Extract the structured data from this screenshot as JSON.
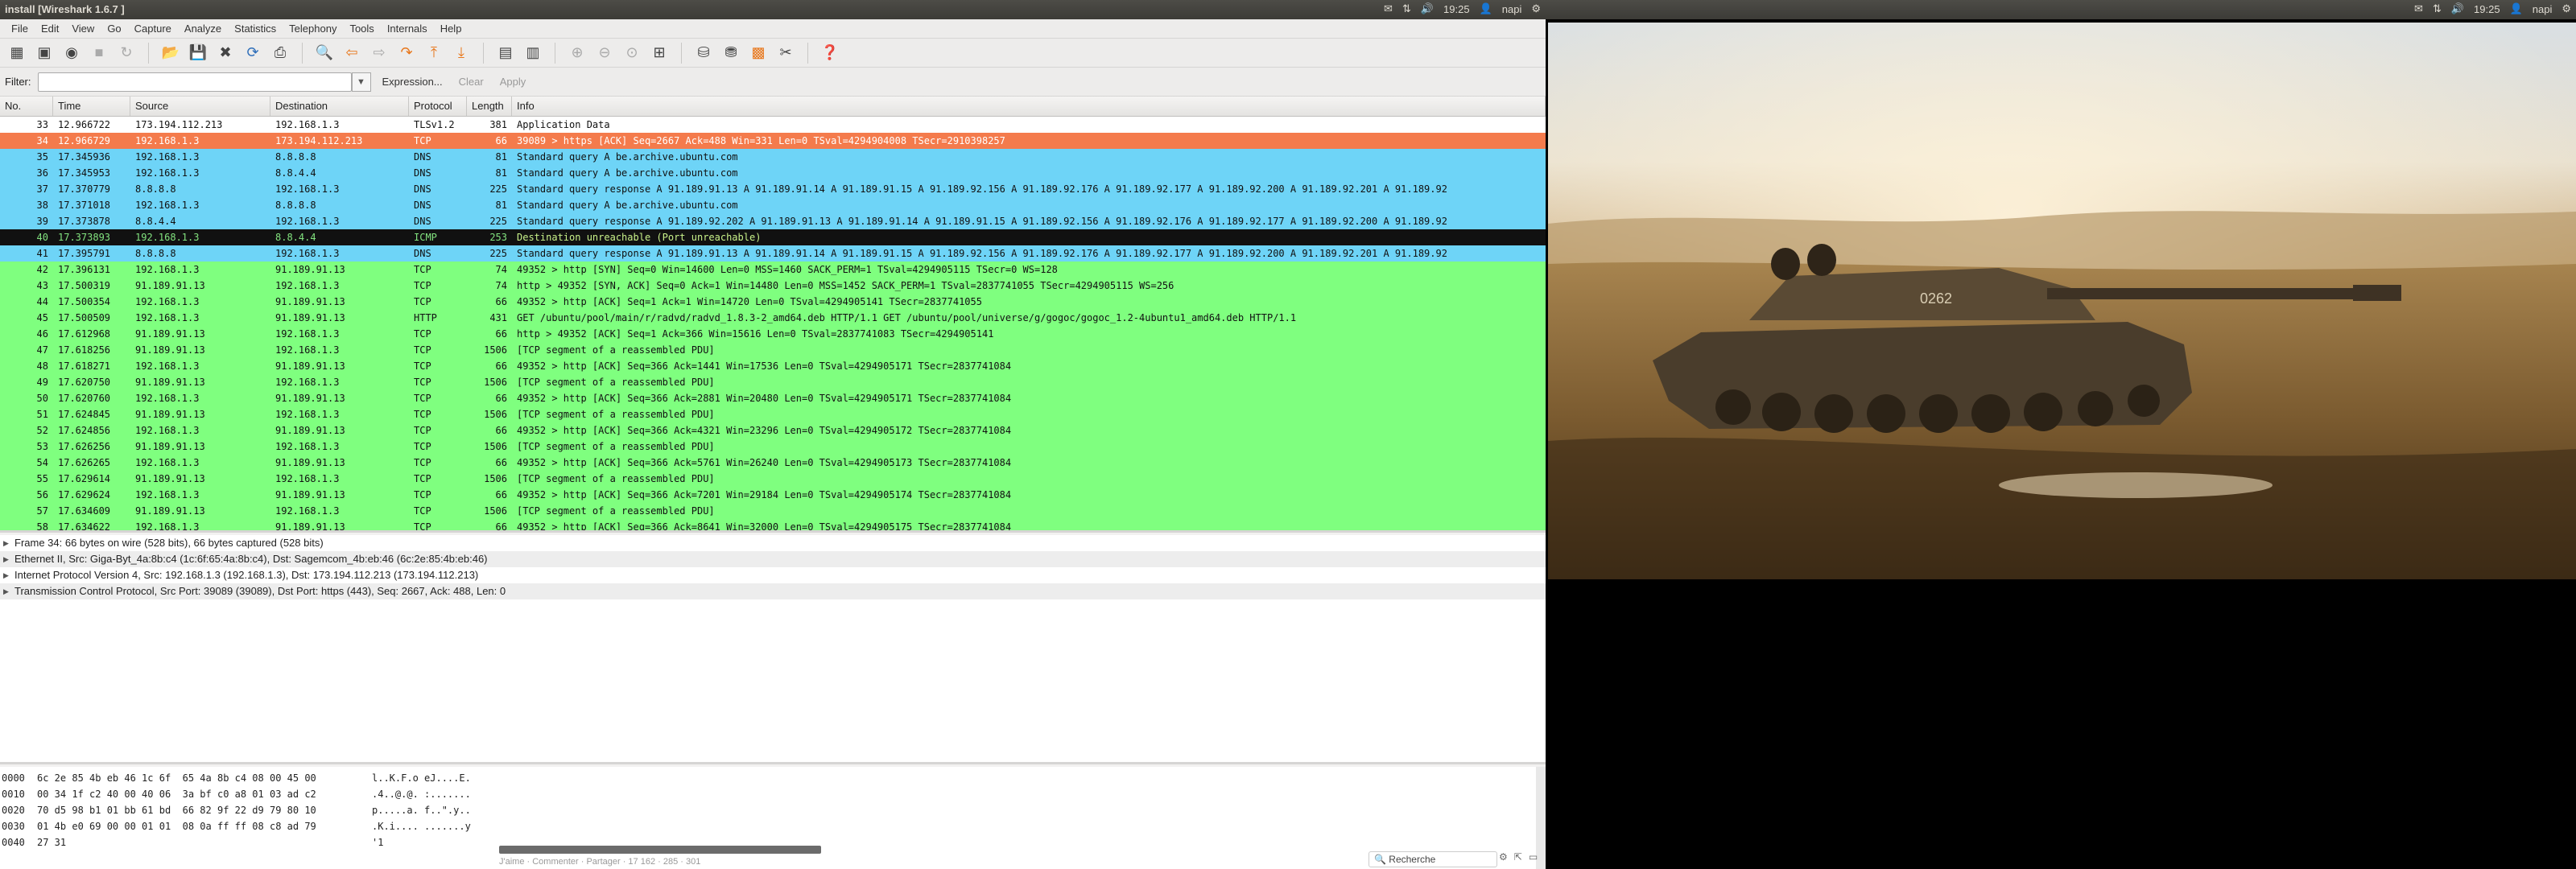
{
  "left_topbar": {
    "title": "install  [Wireshark 1.6.7 ]",
    "time": "19:25",
    "user": "napi"
  },
  "right_topbar": {
    "time": "19:25",
    "user": "napi"
  },
  "menu": [
    "File",
    "Edit",
    "View",
    "Go",
    "Capture",
    "Analyze",
    "Statistics",
    "Telephony",
    "Tools",
    "Internals",
    "Help"
  ],
  "filter": {
    "label": "Filter:",
    "value": "",
    "expression": "Expression...",
    "clear": "Clear",
    "apply": "Apply"
  },
  "columns": {
    "no": "No.",
    "time": "Time",
    "source": "Source",
    "destination": "Destination",
    "protocol": "Protocol",
    "length": "Length",
    "info": "Info"
  },
  "packets": [
    {
      "no": "33",
      "time": "12.966722",
      "src": "173.194.112.213",
      "dst": "192.168.1.3",
      "proto": "TLSv1.2",
      "len": "381",
      "info": "Application Data",
      "cls": "tls"
    },
    {
      "no": "34",
      "time": "12.966729",
      "src": "192.168.1.3",
      "dst": "173.194.112.213",
      "proto": "TCP",
      "len": "66",
      "info": "39089 > https [ACK] Seq=2667 Ack=488 Win=331 Len=0 TSval=4294904008 TSecr=2910398257",
      "cls": "sel"
    },
    {
      "no": "35",
      "time": "17.345936",
      "src": "192.168.1.3",
      "dst": "8.8.8.8",
      "proto": "DNS",
      "len": "81",
      "info": "Standard query A be.archive.ubuntu.com",
      "cls": "dns"
    },
    {
      "no": "36",
      "time": "17.345953",
      "src": "192.168.1.3",
      "dst": "8.8.4.4",
      "proto": "DNS",
      "len": "81",
      "info": "Standard query A be.archive.ubuntu.com",
      "cls": "dns"
    },
    {
      "no": "37",
      "time": "17.370779",
      "src": "8.8.8.8",
      "dst": "192.168.1.3",
      "proto": "DNS",
      "len": "225",
      "info": "Standard query response A 91.189.91.13 A 91.189.91.14 A 91.189.91.15 A 91.189.92.156 A 91.189.92.176 A 91.189.92.177 A 91.189.92.200 A 91.189.92.201 A 91.189.92",
      "cls": "dns"
    },
    {
      "no": "38",
      "time": "17.371018",
      "src": "192.168.1.3",
      "dst": "8.8.8.8",
      "proto": "DNS",
      "len": "81",
      "info": "Standard query A be.archive.ubuntu.com",
      "cls": "dns"
    },
    {
      "no": "39",
      "time": "17.373878",
      "src": "8.8.4.4",
      "dst": "192.168.1.3",
      "proto": "DNS",
      "len": "225",
      "info": "Standard query response A 91.189.92.202 A 91.189.91.13 A 91.189.91.14 A 91.189.91.15 A 91.189.92.156 A 91.189.92.176 A 91.189.92.177 A 91.189.92.200 A 91.189.92",
      "cls": "dns"
    },
    {
      "no": "40",
      "time": "17.373893",
      "src": "192.168.1.3",
      "dst": "8.8.4.4",
      "proto": "ICMP",
      "len": "253",
      "info": "Destination unreachable (Port unreachable)",
      "cls": "icmp"
    },
    {
      "no": "41",
      "time": "17.395791",
      "src": "8.8.8.8",
      "dst": "192.168.1.3",
      "proto": "DNS",
      "len": "225",
      "info": "Standard query response A 91.189.91.13 A 91.189.91.14 A 91.189.91.15 A 91.189.92.156 A 91.189.92.176 A 91.189.92.177 A 91.189.92.200 A 91.189.92.201 A 91.189.92",
      "cls": "dns"
    },
    {
      "no": "42",
      "time": "17.396131",
      "src": "192.168.1.3",
      "dst": "91.189.91.13",
      "proto": "TCP",
      "len": "74",
      "info": "49352 > http [SYN] Seq=0 Win=14600 Len=0 MSS=1460 SACK_PERM=1 TSval=4294905115 TSecr=0 WS=128",
      "cls": "tcp"
    },
    {
      "no": "43",
      "time": "17.500319",
      "src": "91.189.91.13",
      "dst": "192.168.1.3",
      "proto": "TCP",
      "len": "74",
      "info": "http > 49352 [SYN, ACK] Seq=0 Ack=1 Win=14480 Len=0 MSS=1452 SACK_PERM=1 TSval=2837741055 TSecr=4294905115 WS=256",
      "cls": "tcp"
    },
    {
      "no": "44",
      "time": "17.500354",
      "src": "192.168.1.3",
      "dst": "91.189.91.13",
      "proto": "TCP",
      "len": "66",
      "info": "49352 > http [ACK] Seq=1 Ack=1 Win=14720 Len=0 TSval=4294905141 TSecr=2837741055",
      "cls": "tcp"
    },
    {
      "no": "45",
      "time": "17.500509",
      "src": "192.168.1.3",
      "dst": "91.189.91.13",
      "proto": "HTTP",
      "len": "431",
      "info": "GET /ubuntu/pool/main/r/radvd/radvd_1.8.3-2_amd64.deb HTTP/1.1 GET /ubuntu/pool/universe/g/gogoc/gogoc_1.2-4ubuntu1_amd64.deb HTTP/1.1",
      "cls": "http"
    },
    {
      "no": "46",
      "time": "17.612968",
      "src": "91.189.91.13",
      "dst": "192.168.1.3",
      "proto": "TCP",
      "len": "66",
      "info": "http > 49352 [ACK] Seq=1 Ack=366 Win=15616 Len=0 TSval=2837741083 TSecr=4294905141",
      "cls": "tcp"
    },
    {
      "no": "47",
      "time": "17.618256",
      "src": "91.189.91.13",
      "dst": "192.168.1.3",
      "proto": "TCP",
      "len": "1506",
      "info": "[TCP segment of a reassembled PDU]",
      "cls": "tcp"
    },
    {
      "no": "48",
      "time": "17.618271",
      "src": "192.168.1.3",
      "dst": "91.189.91.13",
      "proto": "TCP",
      "len": "66",
      "info": "49352 > http [ACK] Seq=366 Ack=1441 Win=17536 Len=0 TSval=4294905171 TSecr=2837741084",
      "cls": "tcp"
    },
    {
      "no": "49",
      "time": "17.620750",
      "src": "91.189.91.13",
      "dst": "192.168.1.3",
      "proto": "TCP",
      "len": "1506",
      "info": "[TCP segment of a reassembled PDU]",
      "cls": "tcp"
    },
    {
      "no": "50",
      "time": "17.620760",
      "src": "192.168.1.3",
      "dst": "91.189.91.13",
      "proto": "TCP",
      "len": "66",
      "info": "49352 > http [ACK] Seq=366 Ack=2881 Win=20480 Len=0 TSval=4294905171 TSecr=2837741084",
      "cls": "tcp"
    },
    {
      "no": "51",
      "time": "17.624845",
      "src": "91.189.91.13",
      "dst": "192.168.1.3",
      "proto": "TCP",
      "len": "1506",
      "info": "[TCP segment of a reassembled PDU]",
      "cls": "tcp"
    },
    {
      "no": "52",
      "time": "17.624856",
      "src": "192.168.1.3",
      "dst": "91.189.91.13",
      "proto": "TCP",
      "len": "66",
      "info": "49352 > http [ACK] Seq=366 Ack=4321 Win=23296 Len=0 TSval=4294905172 TSecr=2837741084",
      "cls": "tcp"
    },
    {
      "no": "53",
      "time": "17.626256",
      "src": "91.189.91.13",
      "dst": "192.168.1.3",
      "proto": "TCP",
      "len": "1506",
      "info": "[TCP segment of a reassembled PDU]",
      "cls": "tcp"
    },
    {
      "no": "54",
      "time": "17.626265",
      "src": "192.168.1.3",
      "dst": "91.189.91.13",
      "proto": "TCP",
      "len": "66",
      "info": "49352 > http [ACK] Seq=366 Ack=5761 Win=26240 Len=0 TSval=4294905173 TSecr=2837741084",
      "cls": "tcp"
    },
    {
      "no": "55",
      "time": "17.629614",
      "src": "91.189.91.13",
      "dst": "192.168.1.3",
      "proto": "TCP",
      "len": "1506",
      "info": "[TCP segment of a reassembled PDU]",
      "cls": "tcp"
    },
    {
      "no": "56",
      "time": "17.629624",
      "src": "192.168.1.3",
      "dst": "91.189.91.13",
      "proto": "TCP",
      "len": "66",
      "info": "49352 > http [ACK] Seq=366 Ack=7201 Win=29184 Len=0 TSval=4294905174 TSecr=2837741084",
      "cls": "tcp"
    },
    {
      "no": "57",
      "time": "17.634609",
      "src": "91.189.91.13",
      "dst": "192.168.1.3",
      "proto": "TCP",
      "len": "1506",
      "info": "[TCP segment of a reassembled PDU]",
      "cls": "tcp"
    },
    {
      "no": "58",
      "time": "17.634622",
      "src": "192.168.1.3",
      "dst": "91.189.91.13",
      "proto": "TCP",
      "len": "66",
      "info": "49352 > http [ACK] Seq=366 Ack=8641 Win=32000 Len=0 TSval=4294905175 TSecr=2837741084",
      "cls": "tcp"
    }
  ],
  "details": [
    "Frame 34: 66 bytes on wire (528 bits), 66 bytes captured (528 bits)",
    "Ethernet II, Src: Giga-Byt_4a:8b:c4 (1c:6f:65:4a:8b:c4), Dst: Sagemcom_4b:eb:46 (6c:2e:85:4b:eb:46)",
    "Internet Protocol Version 4, Src: 192.168.1.3 (192.168.1.3), Dst: 173.194.112.213 (173.194.112.213)",
    "Transmission Control Protocol, Src Port: 39089 (39089), Dst Port: https (443), Seq: 2667, Ack: 488, Len: 0"
  ],
  "hex": [
    {
      "off": "0000",
      "bytes": "6c 2e 85 4b eb 46 1c 6f  65 4a 8b c4 08 00 45 00",
      "ascii": "l..K.F.o eJ....E."
    },
    {
      "off": "0010",
      "bytes": "00 34 1f c2 40 00 40 06  3a bf c0 a8 01 03 ad c2",
      "ascii": ".4..@.@. :......."
    },
    {
      "off": "0020",
      "bytes": "70 d5 98 b1 01 bb 61 bd  66 82 9f 22 d9 79 80 10",
      "ascii": "p.....a. f..\".y.."
    },
    {
      "off": "0030",
      "bytes": "01 4b e0 69 00 00 01 01  08 0a ff ff 08 c8 ad 79",
      "ascii": ".K.i.... .......y"
    },
    {
      "off": "0040",
      "bytes": "27 31",
      "ascii": "'1"
    }
  ],
  "bottom_bar": {
    "text": "J'aime · Commenter · Partager · 17 162 · 285 · 301",
    "search": "Recherche"
  },
  "photo": {
    "tank_number": "0262"
  }
}
